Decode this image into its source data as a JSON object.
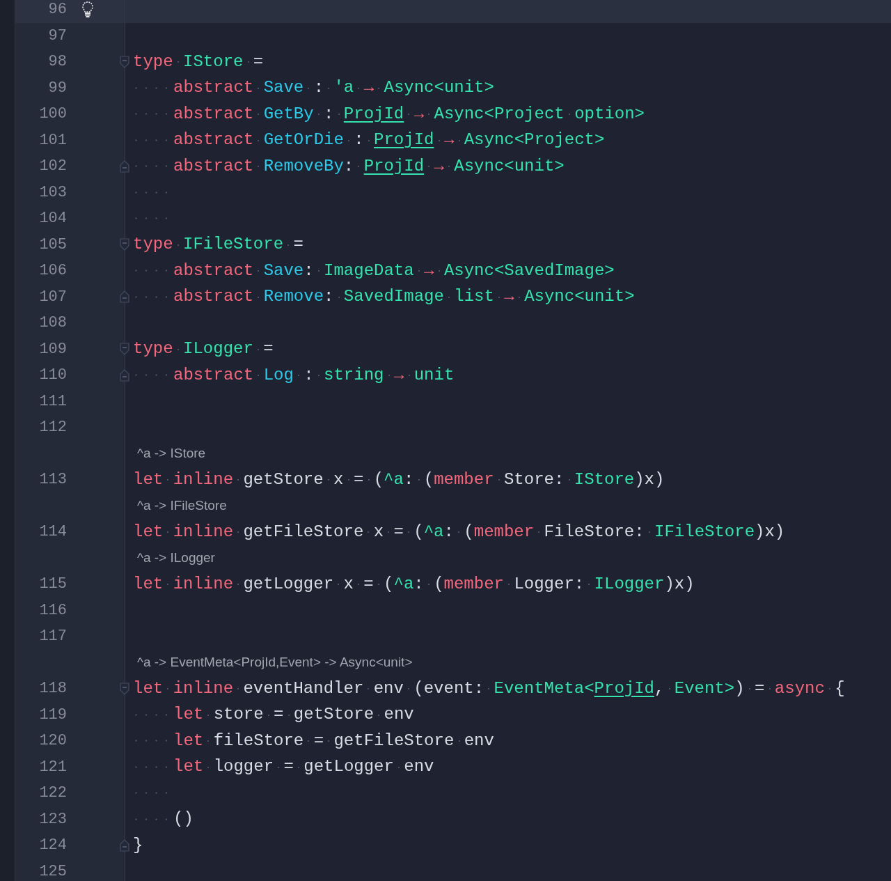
{
  "lines": [
    {
      "number": "96",
      "current": true,
      "bulb": true,
      "indent": false,
      "fold_start": false,
      "fold_end": false
    },
    {
      "number": "97",
      "current": false,
      "bulb": false,
      "indent": false,
      "fold_start": false,
      "fold_end": false
    },
    {
      "number": "98",
      "current": false,
      "bulb": false,
      "indent": false,
      "fold_start": true,
      "fold_end": false,
      "tokens": [
        {
          "kind": "kw",
          "text": "type"
        },
        {
          "kind": "type",
          "text": " IStore"
        },
        {
          "kind": "plain",
          "text": " ="
        }
      ]
    },
    {
      "number": "99",
      "current": false,
      "bulb": false,
      "indent": true,
      "fold_start": false,
      "fold_end": false,
      "tokens": [
        {
          "kind": "kw",
          "text": "abstract"
        },
        {
          "kind": "member",
          "text": " Save"
        },
        {
          "kind": "plain",
          "text": " : "
        },
        {
          "kind": "type",
          "text": "'a"
        },
        {
          "kind": "kw",
          "text": " → "
        },
        {
          "kind": "type",
          "text": "Async<unit>"
        }
      ]
    },
    {
      "number": "100",
      "current": false,
      "bulb": false,
      "indent": true,
      "fold_start": false,
      "fold_end": false,
      "tokens": [
        {
          "kind": "kw",
          "text": "abstract"
        },
        {
          "kind": "member",
          "text": " GetBy"
        },
        {
          "kind": "plain",
          "text": " : "
        },
        {
          "kind": "link",
          "text": "ProjId"
        },
        {
          "kind": "kw",
          "text": " → "
        },
        {
          "kind": "type",
          "text": "Async<Project option>"
        }
      ]
    },
    {
      "number": "101",
      "current": false,
      "bulb": false,
      "indent": true,
      "fold_start": false,
      "fold_end": false,
      "tokens": [
        {
          "kind": "kw",
          "text": "abstract"
        },
        {
          "kind": "member",
          "text": " GetOrDie"
        },
        {
          "kind": "plain",
          "text": " : "
        },
        {
          "kind": "link",
          "text": "ProjId"
        },
        {
          "kind": "kw",
          "text": " → "
        },
        {
          "kind": "type",
          "text": "Async<Project>"
        }
      ]
    },
    {
      "number": "102",
      "current": false,
      "bulb": false,
      "indent": true,
      "fold_start": false,
      "fold_end": true,
      "tokens": [
        {
          "kind": "kw",
          "text": "abstract"
        },
        {
          "kind": "member",
          "text": " RemoveBy"
        },
        {
          "kind": "plain",
          "text": ": "
        },
        {
          "kind": "link",
          "text": "ProjId"
        },
        {
          "kind": "kw",
          "text": " → "
        },
        {
          "kind": "type",
          "text": "Async<unit>"
        }
      ]
    },
    {
      "number": "103",
      "current": false,
      "bulb": false,
      "indent": true,
      "fold_start": false,
      "fold_end": false
    },
    {
      "number": "104",
      "current": false,
      "bulb": false,
      "indent": true,
      "fold_start": false,
      "fold_end": false
    },
    {
      "number": "105",
      "current": false,
      "bulb": false,
      "indent": false,
      "fold_start": true,
      "fold_end": false,
      "tokens": [
        {
          "kind": "kw",
          "text": "type"
        },
        {
          "kind": "type",
          "text": " IFileStore"
        },
        {
          "kind": "plain",
          "text": " ="
        }
      ]
    },
    {
      "number": "106",
      "current": false,
      "bulb": false,
      "indent": true,
      "fold_start": false,
      "fold_end": false,
      "tokens": [
        {
          "kind": "kw",
          "text": "abstract"
        },
        {
          "kind": "member",
          "text": " Save"
        },
        {
          "kind": "plain",
          "text": ": "
        },
        {
          "kind": "type",
          "text": "ImageData"
        },
        {
          "kind": "kw",
          "text": " → "
        },
        {
          "kind": "type",
          "text": "Async<SavedImage>"
        }
      ]
    },
    {
      "number": "107",
      "current": false,
      "bulb": false,
      "indent": true,
      "fold_start": false,
      "fold_end": true,
      "tokens": [
        {
          "kind": "kw",
          "text": "abstract"
        },
        {
          "kind": "member",
          "text": " Remove"
        },
        {
          "kind": "plain",
          "text": ": "
        },
        {
          "kind": "type",
          "text": "SavedImage list"
        },
        {
          "kind": "kw",
          "text": " → "
        },
        {
          "kind": "type",
          "text": "Async<unit>"
        }
      ]
    },
    {
      "number": "108",
      "current": false,
      "bulb": false,
      "indent": false,
      "fold_start": false,
      "fold_end": false
    },
    {
      "number": "109",
      "current": false,
      "bulb": false,
      "indent": false,
      "fold_start": true,
      "fold_end": false,
      "tokens": [
        {
          "kind": "kw",
          "text": "type"
        },
        {
          "kind": "type",
          "text": " ILogger"
        },
        {
          "kind": "plain",
          "text": " ="
        }
      ]
    },
    {
      "number": "110",
      "current": false,
      "bulb": false,
      "indent": true,
      "fold_start": false,
      "fold_end": true,
      "tokens": [
        {
          "kind": "kw",
          "text": "abstract"
        },
        {
          "kind": "member",
          "text": " Log"
        },
        {
          "kind": "plain",
          "text": " : "
        },
        {
          "kind": "type",
          "text": "string"
        },
        {
          "kind": "kw",
          "text": " → "
        },
        {
          "kind": "type",
          "text": "unit"
        }
      ]
    },
    {
      "number": "111",
      "current": false,
      "bulb": false,
      "indent": false,
      "fold_start": false,
      "fold_end": false
    },
    {
      "number": "112",
      "current": false,
      "bulb": false,
      "indent": false,
      "fold_start": false,
      "fold_end": false
    },
    {
      "number": "113",
      "current": false,
      "bulb": false,
      "indent": false,
      "fold_start": false,
      "fold_end": false,
      "hint": "^a -> IStore",
      "tokens": [
        {
          "kind": "kw",
          "text": "let"
        },
        {
          "kind": "kw",
          "text": " inline"
        },
        {
          "kind": "plain",
          "text": " getStore x = ("
        },
        {
          "kind": "type",
          "text": "^a"
        },
        {
          "kind": "plain",
          "text": ": ("
        },
        {
          "kind": "kw",
          "text": "member"
        },
        {
          "kind": "plain",
          "text": " Store: "
        },
        {
          "kind": "type",
          "text": "IStore"
        },
        {
          "kind": "plain",
          "text": ")x)"
        }
      ]
    },
    {
      "number": "114",
      "current": false,
      "bulb": false,
      "indent": false,
      "fold_start": false,
      "fold_end": false,
      "hint": "^a -> IFileStore",
      "tokens": [
        {
          "kind": "kw",
          "text": "let"
        },
        {
          "kind": "kw",
          "text": " inline"
        },
        {
          "kind": "plain",
          "text": " getFileStore x = ("
        },
        {
          "kind": "type",
          "text": "^a"
        },
        {
          "kind": "plain",
          "text": ": ("
        },
        {
          "kind": "kw",
          "text": "member"
        },
        {
          "kind": "plain",
          "text": " FileStore: "
        },
        {
          "kind": "type",
          "text": "IFileStore"
        },
        {
          "kind": "plain",
          "text": ")x)"
        }
      ]
    },
    {
      "number": "115",
      "current": false,
      "bulb": false,
      "indent": false,
      "fold_start": false,
      "fold_end": false,
      "hint": "^a -> ILogger",
      "tokens": [
        {
          "kind": "kw",
          "text": "let"
        },
        {
          "kind": "kw",
          "text": " inline"
        },
        {
          "kind": "plain",
          "text": " getLogger x = ("
        },
        {
          "kind": "type",
          "text": "^a"
        },
        {
          "kind": "plain",
          "text": ": ("
        },
        {
          "kind": "kw",
          "text": "member"
        },
        {
          "kind": "plain",
          "text": " Logger: "
        },
        {
          "kind": "type",
          "text": "ILogger"
        },
        {
          "kind": "plain",
          "text": ")x)"
        }
      ]
    },
    {
      "number": "116",
      "current": false,
      "bulb": false,
      "indent": false,
      "fold_start": false,
      "fold_end": false
    },
    {
      "number": "117",
      "current": false,
      "bulb": false,
      "indent": false,
      "fold_start": false,
      "fold_end": false
    },
    {
      "number": "118",
      "current": false,
      "bulb": false,
      "indent": false,
      "fold_start": true,
      "fold_end": false,
      "hint": "^a -> EventMeta<ProjId,Event> -> Async<unit>",
      "tokens": [
        {
          "kind": "kw",
          "text": "let"
        },
        {
          "kind": "kw",
          "text": " inline"
        },
        {
          "kind": "plain",
          "text": " eventHandler env (event: "
        },
        {
          "kind": "type",
          "text": "EventMeta<"
        },
        {
          "kind": "link",
          "text": "ProjId"
        },
        {
          "kind": "plain",
          "text": ", "
        },
        {
          "kind": "type",
          "text": "Event>"
        },
        {
          "kind": "plain",
          "text": ") = "
        },
        {
          "kind": "kw",
          "text": "async"
        },
        {
          "kind": "plain",
          "text": " {"
        }
      ]
    },
    {
      "number": "119",
      "current": false,
      "bulb": false,
      "indent": true,
      "fold_start": false,
      "fold_end": false,
      "tokens": [
        {
          "kind": "kw",
          "text": "let"
        },
        {
          "kind": "plain",
          "text": " store = getStore env"
        }
      ]
    },
    {
      "number": "120",
      "current": false,
      "bulb": false,
      "indent": true,
      "fold_start": false,
      "fold_end": false,
      "tokens": [
        {
          "kind": "kw",
          "text": "let"
        },
        {
          "kind": "plain",
          "text": " fileStore = getFileStore env"
        }
      ]
    },
    {
      "number": "121",
      "current": false,
      "bulb": false,
      "indent": true,
      "fold_start": false,
      "fold_end": false,
      "tokens": [
        {
          "kind": "kw",
          "text": "let"
        },
        {
          "kind": "plain",
          "text": " logger = getLogger env"
        }
      ]
    },
    {
      "number": "122",
      "current": false,
      "bulb": false,
      "indent": true,
      "fold_start": false,
      "fold_end": false
    },
    {
      "number": "123",
      "current": false,
      "bulb": false,
      "indent": true,
      "fold_start": false,
      "fold_end": false,
      "tokens": [
        {
          "kind": "plain",
          "text": "()"
        }
      ]
    },
    {
      "number": "124",
      "current": false,
      "bulb": false,
      "indent": false,
      "fold_start": false,
      "fold_end": true,
      "tokens": [
        {
          "kind": "plain",
          "text": "}"
        }
      ]
    },
    {
      "number": "125",
      "current": false,
      "bulb": false,
      "indent": false,
      "fold_start": false,
      "fold_end": false
    }
  ]
}
